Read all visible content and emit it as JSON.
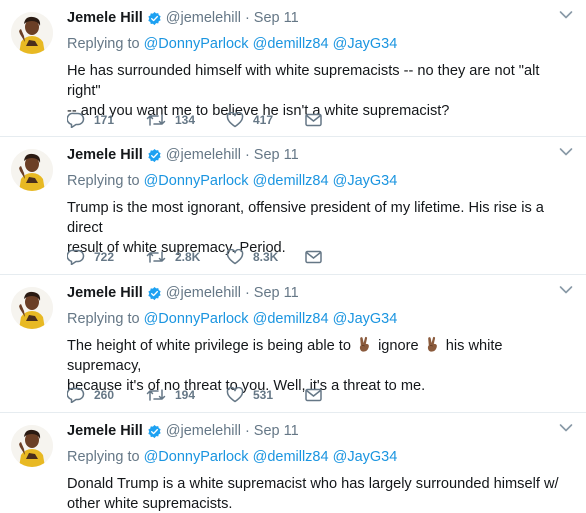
{
  "colors": {
    "link": "#1b95e0",
    "muted": "#657786",
    "text": "#14171a",
    "verified": "#1da1f2",
    "divider": "#e6ecf0"
  },
  "icons": {
    "verified": "verified-badge-icon",
    "chevron": "chevron-down-icon",
    "reply": "reply-icon",
    "retweet": "retweet-icon",
    "like": "heart-icon",
    "dm": "envelope-icon",
    "emoji": "victory-hand-medium-dark-skin-tone-emoji"
  },
  "tweets": [
    {
      "name": "Jemele Hill",
      "handle": "@jemelehill",
      "dot": "·",
      "date": "Sep 11",
      "replying_prefix": "Replying to",
      "mentions": [
        "@DonnyParlock",
        "@demillz84",
        "@JayG34"
      ],
      "text_lines": [
        "He has surrounded himself with white supremacists -- no they are not \"alt right\"",
        "-- and you want me to believe he isn't a white supremacist?"
      ],
      "replies": "171",
      "retweets": "134",
      "likes": "417"
    },
    {
      "name": "Jemele Hill",
      "handle": "@jemelehill",
      "dot": "·",
      "date": "Sep 11",
      "replying_prefix": "Replying to",
      "mentions": [
        "@DonnyParlock",
        "@demillz84",
        "@JayG34"
      ],
      "text_lines": [
        "Trump is the most ignorant, offensive president of my lifetime. His rise is a direct",
        "result of white supremacy. Period."
      ],
      "replies": "722",
      "retweets": "2.8K",
      "likes": "8.3K"
    },
    {
      "name": "Jemele Hill",
      "handle": "@jemelehill",
      "dot": "·",
      "date": "Sep 11",
      "replying_prefix": "Replying to",
      "mentions": [
        "@DonnyParlock",
        "@demillz84",
        "@JayG34"
      ],
      "text_parts": [
        "The height of white privilege is being able to ",
        "ignore",
        "his white supremacy,"
      ],
      "text_line2": "because it's of no threat to you. Well, it's a threat to me.",
      "replies": "260",
      "retweets": "194",
      "likes": "531"
    },
    {
      "name": "Jemele Hill",
      "handle": "@jemelehill",
      "dot": "·",
      "date": "Sep 11",
      "replying_prefix": "Replying to",
      "mentions": [
        "@DonnyParlock",
        "@demillz84",
        "@JayG34"
      ],
      "text_lines": [
        "Donald Trump is a white supremacist who has largely surrounded himself w/",
        "other white supremacists."
      ]
    }
  ]
}
